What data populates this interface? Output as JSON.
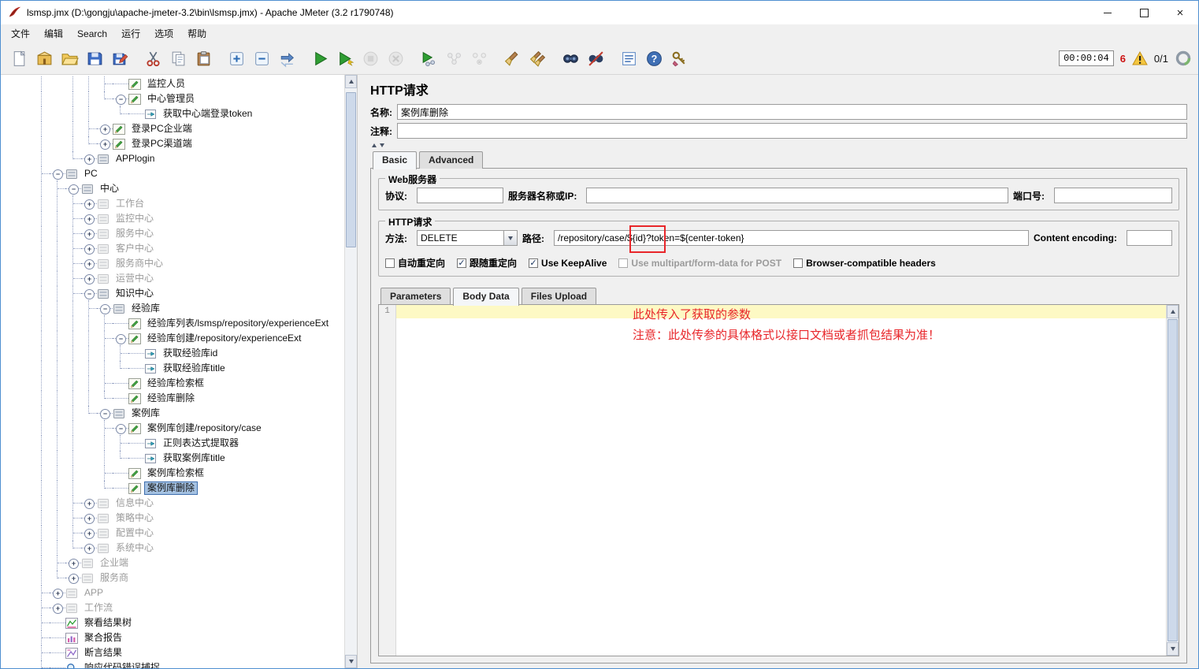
{
  "window": {
    "title": "lsmsp.jmx (D:\\gongju\\apache-jmeter-3.2\\bin\\lsmsp.jmx) - Apache JMeter (3.2 r1790748)"
  },
  "menu": {
    "items": [
      "文件",
      "编辑",
      "Search",
      "运行",
      "选项",
      "帮助"
    ]
  },
  "toolbar": {
    "timer": "00:00:04",
    "error_count": "6",
    "threads": "0/1",
    "groups": [
      [
        "new",
        "templates",
        "open",
        "save",
        "save-as"
      ],
      [
        "cut",
        "copy",
        "paste"
      ],
      [
        "expand-all",
        "collapse-all",
        "toggle"
      ],
      [
        "start",
        "start-no-pauses",
        "stop",
        "shutdown"
      ],
      [
        "remote-start",
        "remote-start-all",
        "remote-stop-all"
      ],
      [
        "clear",
        "clear-all"
      ],
      [
        "search",
        "search-reset"
      ],
      [
        "function-helper",
        "help",
        "ssl-manager"
      ]
    ],
    "disabled": [
      "stop",
      "shutdown",
      "remote-start-all",
      "remote-stop-all"
    ]
  },
  "tree": {
    "items": [
      {
        "label": "监控人员",
        "level": 6,
        "icon": "sampler-pencil"
      },
      {
        "label": "中心管理员",
        "level": 6,
        "icon": "sampler-pencil",
        "handle": "minus"
      },
      {
        "label": "获取中心端登录token",
        "level": 7,
        "icon": "extractor-arrow"
      },
      {
        "label": "登录PC企业端",
        "level": 5,
        "icon": "sampler-pencil",
        "handle": "plus"
      },
      {
        "label": "登录PC渠道端",
        "level": 5,
        "icon": "sampler-pencil",
        "handle": "plus"
      },
      {
        "label": "APPlogin",
        "level": 4,
        "icon": "controller-box",
        "handle": "plus"
      },
      {
        "label": "PC",
        "level": 2,
        "icon": "controller-box",
        "handle": "minus"
      },
      {
        "label": "中心",
        "level": 3,
        "icon": "controller-box",
        "handle": "minus"
      },
      {
        "label": "工作台",
        "level": 4,
        "icon": "controller-box",
        "handle": "plus",
        "disabled": true
      },
      {
        "label": "监控中心",
        "level": 4,
        "icon": "controller-box",
        "handle": "plus",
        "disabled": true
      },
      {
        "label": "服务中心",
        "level": 4,
        "icon": "controller-box",
        "handle": "plus",
        "disabled": true
      },
      {
        "label": "客户中心",
        "level": 4,
        "icon": "controller-box",
        "handle": "plus",
        "disabled": true
      },
      {
        "label": "服务商中心",
        "level": 4,
        "icon": "controller-box",
        "handle": "plus",
        "disabled": true
      },
      {
        "label": "运营中心",
        "level": 4,
        "icon": "controller-box",
        "handle": "plus",
        "disabled": true
      },
      {
        "label": "知识中心",
        "level": 4,
        "icon": "controller-box",
        "handle": "minus"
      },
      {
        "label": "经验库",
        "level": 5,
        "icon": "controller-box",
        "handle": "minus"
      },
      {
        "label": "经验库列表/lsmsp/repository/experienceExt",
        "level": 6,
        "icon": "sampler-pencil"
      },
      {
        "label": "经验库创建/repository/experienceExt",
        "level": 6,
        "icon": "sampler-pencil",
        "handle": "minus"
      },
      {
        "label": "获取经验库id",
        "level": 7,
        "icon": "extractor-arrow"
      },
      {
        "label": "获取经验库title",
        "level": 7,
        "icon": "extractor-arrow"
      },
      {
        "label": "经验库检索框",
        "level": 6,
        "icon": "sampler-pencil"
      },
      {
        "label": "经验库删除",
        "level": 6,
        "icon": "sampler-pencil"
      },
      {
        "label": "案例库",
        "level": 5,
        "icon": "controller-box",
        "handle": "minus"
      },
      {
        "label": "案例库创建/repository/case",
        "level": 6,
        "icon": "s​ampler-pencil",
        "handle": "minus"
      },
      {
        "label": "正则表达式提取器",
        "level": 7,
        "icon": "extractor-arrow"
      },
      {
        "label": "获取案例库title",
        "level": 7,
        "icon": "extractor-arrow"
      },
      {
        "label": "案例库检索框",
        "level": 6,
        "icon": "sampler-pencil"
      },
      {
        "label": "案例库删除",
        "level": 6,
        "icon": "sampler-pencil",
        "selected": true
      },
      {
        "label": "信息中心",
        "level": 4,
        "icon": "controller-box",
        "handle": "plus",
        "disabled": true
      },
      {
        "label": "策略中心",
        "level": 4,
        "icon": "controller-box",
        "handle": "plus",
        "disabled": true
      },
      {
        "label": "配置中心",
        "level": 4,
        "icon": "controller-box",
        "handle": "plus",
        "disabled": true
      },
      {
        "label": "系统中心",
        "level": 4,
        "icon": "controller-box",
        "handle": "plus",
        "disabled": true
      },
      {
        "label": "企业端",
        "level": 3,
        "icon": "controller-box",
        "handle": "plus",
        "disabled": true
      },
      {
        "label": "服务商",
        "level": 3,
        "icon": "controller-box",
        "handle": "plus",
        "disabled": true
      },
      {
        "label": "APP",
        "level": 2,
        "icon": "controller-box",
        "handle": "plus",
        "disabled": true
      },
      {
        "label": "工作流",
        "level": 2,
        "icon": "controller-box",
        "handle": "plus",
        "disabled": true
      },
      {
        "label": "察看结果树",
        "level": 2,
        "icon": "listener-chart-green"
      },
      {
        "label": "聚合报告",
        "level": 2,
        "icon": "listener-chart-pink"
      },
      {
        "label": "断言结果",
        "level": 2,
        "icon": "listener-chart-purple"
      },
      {
        "label": "响应代码错误捕捉",
        "level": 2,
        "icon": "capture-magnifier"
      }
    ]
  },
  "editor": {
    "title": "HTTP请求",
    "name_label": "名称:",
    "name_value": "案例库删除",
    "comment_label": "注释:",
    "tabs_basic": {
      "items": [
        "Basic",
        "Advanced"
      ],
      "selected": 0
    },
    "web_server": {
      "title": "Web服务器",
      "protocol_label": "协议:",
      "server_label": "服务器名称或IP:",
      "port_label": "端口号:"
    },
    "http_request": {
      "title": "HTTP请求",
      "method_label": "方法:",
      "method_value": "DELETE",
      "path_label": "路径:",
      "path_value": "/repository/case/${id}?token=${center-token}",
      "content_encoding_label": "Content encoding:",
      "checkboxes": [
        {
          "key": "auto-redirect",
          "label": "自动重定向",
          "checked": false
        },
        {
          "key": "follow-redirects",
          "label": "跟随重定向",
          "checked": true
        },
        {
          "key": "use-keepalive",
          "label": "Use KeepAlive",
          "checked": true
        },
        {
          "key": "multipart-post",
          "label": "Use multipart/form-data for POST",
          "checked": false,
          "muted": true
        },
        {
          "key": "browser-headers",
          "label": "Browser-compatible headers",
          "checked": false
        }
      ]
    },
    "tabs_body": {
      "items": [
        "Parameters",
        "Body Data",
        "Files Upload"
      ],
      "selected": 1
    },
    "body": {
      "line_number": "1",
      "annotation_line1": "此处传入了获取的参数",
      "annotation_line2": "注意：此处传参的具体格式以接口文档或者抓包结果为准！"
    }
  },
  "colors": {
    "annotation_red": "#e8262a",
    "selection_blue": "#a5c2e2",
    "warning_yellow": "#f4c63f",
    "start_green": "#2f9e33"
  }
}
